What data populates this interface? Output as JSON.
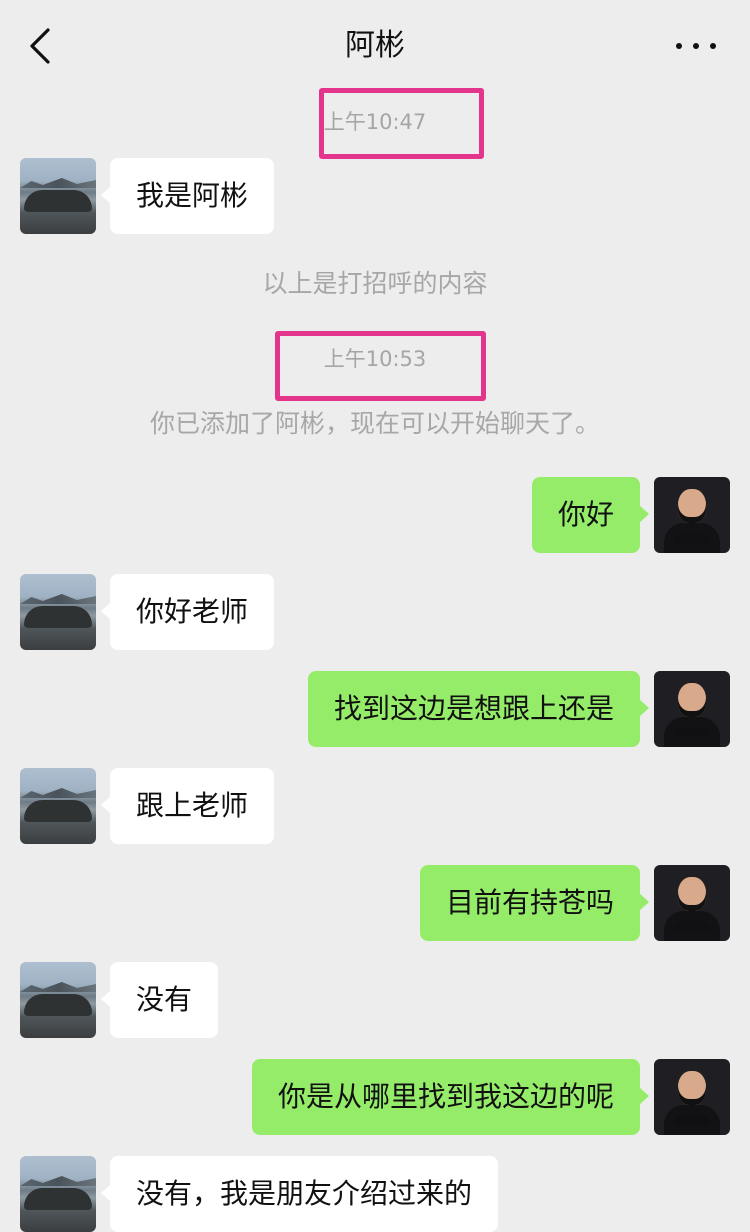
{
  "header": {
    "title": "阿彬",
    "back_icon": "chevron-left-icon",
    "more_icon": "more-horizontal-icon"
  },
  "highlight_color": "#e4358c",
  "bubble_colors": {
    "incoming": "#ffffff",
    "outgoing": "#95ec69"
  },
  "chat": {
    "timestamp_1": "上午10:47",
    "msg_1": "我是阿彬",
    "system_1": "以上是打招呼的内容",
    "timestamp_2": "上午10:53",
    "system_2": "你已添加了阿彬，现在可以开始聊天了。",
    "msg_2": "你好",
    "msg_3": "你好老师",
    "msg_4": "找到这边是想跟上还是",
    "msg_5": "跟上老师",
    "msg_6": "目前有持苍吗",
    "msg_7": "没有",
    "msg_8": "你是从哪里找到我这边的呢",
    "msg_9": "没有，我是朋友介绍过来的"
  }
}
